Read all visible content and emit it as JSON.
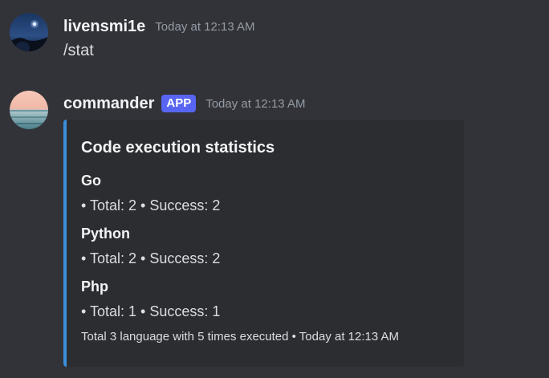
{
  "messages": [
    {
      "username": "livensmi1e",
      "timestamp": "Today at 12:13 AM",
      "content": "/stat"
    },
    {
      "username": "commander",
      "badge": "APP",
      "timestamp": "Today at 12:13 AM",
      "embed": {
        "accent_color": "#3c8fda",
        "title": "Code execution statistics",
        "fields": [
          {
            "name": "Go",
            "value": "• Total: 2 • Success: 2"
          },
          {
            "name": "Python",
            "value": "• Total: 2 • Success: 2"
          },
          {
            "name": "Php",
            "value": "• Total: 1 • Success: 1"
          }
        ],
        "footer": "Total 3 language with 5 times executed • Today at 12:13 AM"
      }
    }
  ],
  "colors": {
    "background": "#323339",
    "embed_background": "#2b2d31",
    "app_badge": "#5865f2",
    "timestamp": "#949ba4"
  }
}
